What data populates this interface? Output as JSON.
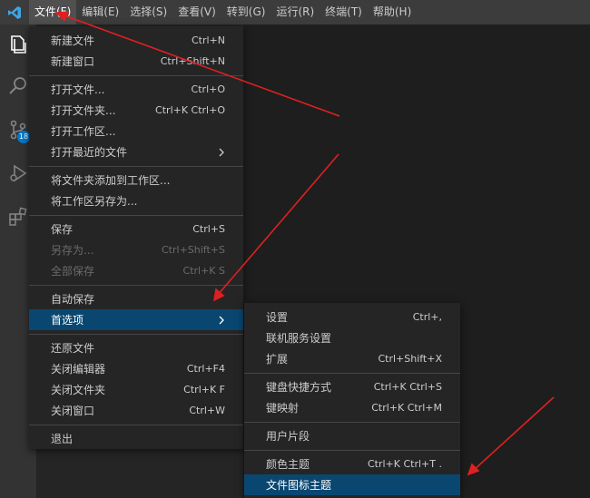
{
  "menubar": {
    "items": [
      "文件(F)",
      "编辑(E)",
      "选择(S)",
      "查看(V)",
      "转到(G)",
      "运行(R)",
      "终端(T)",
      "帮助(H)"
    ]
  },
  "activity": {
    "badge": "18"
  },
  "file_menu": {
    "new_file": {
      "label": "新建文件",
      "key": "Ctrl+N"
    },
    "new_window": {
      "label": "新建窗口",
      "key": "Ctrl+Shift+N"
    },
    "open_file": {
      "label": "打开文件...",
      "key": "Ctrl+O"
    },
    "open_folder": {
      "label": "打开文件夹...",
      "key": "Ctrl+K Ctrl+O"
    },
    "open_workspace": {
      "label": "打开工作区..."
    },
    "open_recent": {
      "label": "打开最近的文件"
    },
    "add_folder_to_workspace": {
      "label": "将文件夹添加到工作区..."
    },
    "save_workspace_as": {
      "label": "将工作区另存为..."
    },
    "save": {
      "label": "保存",
      "key": "Ctrl+S"
    },
    "save_as": {
      "label": "另存为...",
      "key": "Ctrl+Shift+S"
    },
    "save_all": {
      "label": "全部保存",
      "key": "Ctrl+K S"
    },
    "auto_save": {
      "label": "自动保存"
    },
    "preferences": {
      "label": "首选项"
    },
    "revert_file": {
      "label": "还原文件"
    },
    "close_editor": {
      "label": "关闭编辑器",
      "key": "Ctrl+F4"
    },
    "close_folder": {
      "label": "关闭文件夹",
      "key": "Ctrl+K F"
    },
    "close_window": {
      "label": "关闭窗口",
      "key": "Ctrl+W"
    },
    "exit": {
      "label": "退出"
    }
  },
  "prefs_menu": {
    "settings": {
      "label": "设置",
      "key": "Ctrl+,"
    },
    "online_services": {
      "label": "联机服务设置"
    },
    "extensions": {
      "label": "扩展",
      "key": "Ctrl+Shift+X"
    },
    "keyboard_shortcuts": {
      "label": "键盘快捷方式",
      "key": "Ctrl+K Ctrl+S"
    },
    "keymaps": {
      "label": "键映射",
      "key": "Ctrl+K Ctrl+M"
    },
    "user_snippets": {
      "label": "用户片段"
    },
    "color_theme": {
      "label": "颜色主题",
      "key": "Ctrl+K Ctrl+T ."
    },
    "file_icon_theme": {
      "label": "文件图标主题"
    }
  },
  "colors": {
    "accent": "#007acc",
    "selection": "#094771",
    "annotation": "#e02020"
  }
}
